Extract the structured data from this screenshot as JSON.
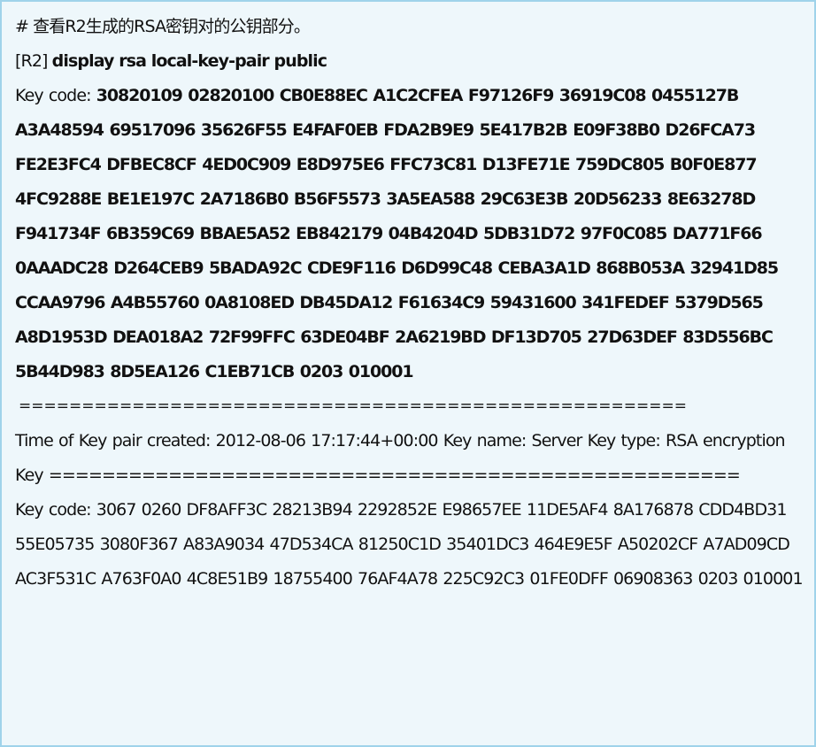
{
  "comment": "# 查看R2生成的RSA密钥对的公钥部分。",
  "command": {
    "prompt": "[R2]",
    "text": "display rsa local-key-pair public"
  },
  "host_key": {
    "label": "Key code:",
    "value": "30820109 02820100 CB0E88EC A1C2CFEA F97126F9 36919C08 0455127B A3A48594 69517096 35626F55 E4FAF0EB FDA2B9E9 5E417B2B E09F38B0 D26FCA73 FE2E3FC4 DFBEC8CF 4ED0C909 E8D975E6 FFC73C81 D13FE71E 759DC805 B0F0E877 4FC9288E BE1E197C 2A7186B0 B56F5573 3A5EA588 29C63E3B 20D56233 8E63278D F941734F 6B359C69 BBAE5A52 EB842179 04B4204D 5DB31D72 97F0C085 DA771F66 0AAADC28 D264CEB9 5BADA92C CDE9F116 D6D99C48 CEBA3A1D 868B053A 32941D85 CCAA9796 A4B55760 0A8108ED DB45DA12 F61634C9 59431600 341FEDEF 5379D565 A8D1953D DEA018A2 72F99FFC 63DE04BF 2A6219BD DF13D705 27D63DEF 83D556BC 5B44D983 8D5EA126 C1EB71CB 0203 010001"
  },
  "separator": "=====================================================",
  "server_info": "Time of Key pair created: 2012-08-06 17:17:44+00:00 Key name: Server Key type: RSA encryption Key ====================================================",
  "server_key": {
    "label": "Key code:",
    "value": "3067 0260 DF8AFF3C 28213B94 2292852E E98657EE 11DE5AF4 8A176878 CDD4BD31 55E05735 3080F367 A83A9034 47D534CA 81250C1D 35401DC3 464E9E5F A50202CF A7AD09CD AC3F531C A763F0A0 4C8E51B9 18755400 76AF4A78 225C92C3 01FE0DFF 06908363 0203 010001"
  }
}
